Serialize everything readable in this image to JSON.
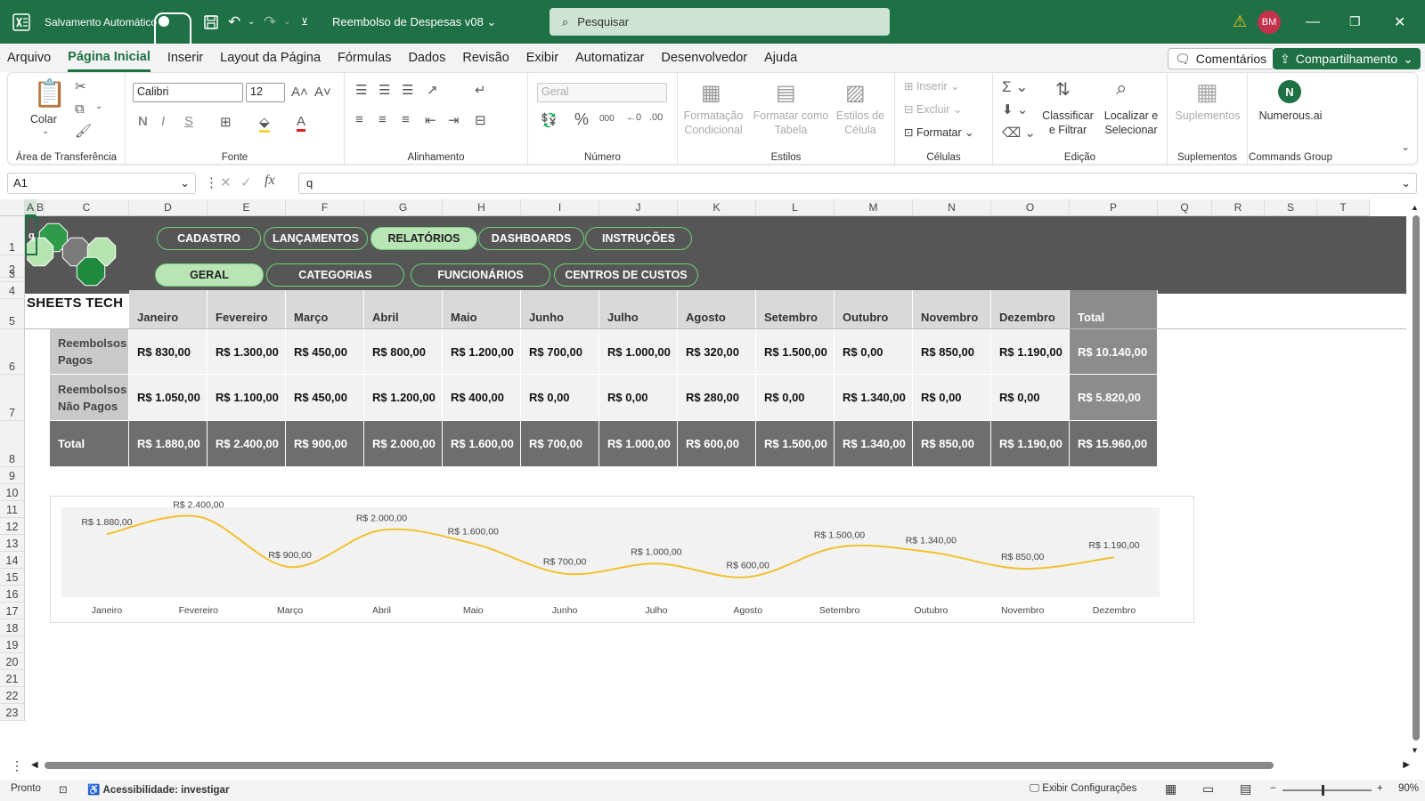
{
  "titlebar": {
    "autosave_label": "Salvamento Automático",
    "doc_title": "Reembolso de Despesas v08",
    "search_placeholder": "Pesquisar",
    "avatar": "BM"
  },
  "menu": {
    "items": [
      "Arquivo",
      "Página Inicial",
      "Inserir",
      "Layout da Página",
      "Fórmulas",
      "Dados",
      "Revisão",
      "Exibir",
      "Automatizar",
      "Desenvolvedor",
      "Ajuda"
    ],
    "active": "Página Inicial",
    "comments": "Comentários",
    "share": "Compartilhamento"
  },
  "ribbon": {
    "clipboard": {
      "paste": "Colar",
      "label": "Área de Transferência"
    },
    "font": {
      "name": "Calibri",
      "size": "12",
      "label": "Fonte",
      "bold": "N",
      "italic": "I",
      "underline": "S"
    },
    "alignment": {
      "label": "Alinhamento"
    },
    "number": {
      "format": "Geral",
      "label": "Número",
      "percent": "%",
      "thousands": "000"
    },
    "styles": {
      "cond": "Formatação Condicional",
      "table": "Formatar como Tabela",
      "cell": "Estilos de Célula",
      "label": "Estilos"
    },
    "cells": {
      "insert": "Inserir",
      "delete": "Excluir",
      "format": "Formatar",
      "label": "Células"
    },
    "editing": {
      "sort": "Classificar e Filtrar",
      "find": "Localizar e Selecionar",
      "label": "Edição"
    },
    "addins": {
      "btn": "Suplementos",
      "label": "Suplementos"
    },
    "commands": {
      "btn": "Numerous.ai",
      "label": "Commands Group"
    }
  },
  "formula_bar": {
    "cell_ref": "A1",
    "content": "q",
    "fx": "fx"
  },
  "columns": [
    "A",
    "B",
    "C",
    "D",
    "E",
    "F",
    "G",
    "H",
    "I",
    "J",
    "K",
    "L",
    "M",
    "N",
    "O",
    "P",
    "Q",
    "R",
    "S",
    "T"
  ],
  "rows": [
    "1",
    "2",
    "3",
    "4",
    "5",
    "6",
    "7",
    "8",
    "9",
    "10",
    "11",
    "12",
    "13",
    "14",
    "15",
    "16",
    "17",
    "18",
    "19",
    "20",
    "21",
    "22",
    "23"
  ],
  "a1_value": "q",
  "nav_top": [
    "CADASTRO",
    "LANÇAMENTOS",
    "RELATÓRIOS",
    "DASHBOARDS",
    "INSTRUÇÕES"
  ],
  "nav_top_active": "RELATÓRIOS",
  "nav_sub": [
    "GERAL",
    "CATEGORIAS",
    "FUNCIONÁRIOS",
    "CENTROS DE CUSTOS"
  ],
  "nav_sub_active": "GERAL",
  "brand": "SHEETS TECH",
  "table": {
    "months": [
      "Janeiro",
      "Fevereiro",
      "Março",
      "Abril",
      "Maio",
      "Junho",
      "Julho",
      "Agosto",
      "Setembro",
      "Outubro",
      "Novembro",
      "Dezembro",
      "Total"
    ],
    "rows": [
      {
        "label": "Reembolsos Pagos",
        "values": [
          "R$ 830,00",
          "R$ 1.300,00",
          "R$ 450,00",
          "R$ 800,00",
          "R$ 1.200,00",
          "R$ 700,00",
          "R$ 1.000,00",
          "R$ 320,00",
          "R$ 1.500,00",
          "R$ 0,00",
          "R$ 850,00",
          "R$ 1.190,00",
          "R$ 10.140,00"
        ]
      },
      {
        "label": "Reembolsos Não Pagos",
        "values": [
          "R$ 1.050,00",
          "R$ 1.100,00",
          "R$ 450,00",
          "R$ 1.200,00",
          "R$ 400,00",
          "R$ 0,00",
          "R$ 0,00",
          "R$ 280,00",
          "R$ 0,00",
          "R$ 1.340,00",
          "R$ 0,00",
          "R$ 0,00",
          "R$ 5.820,00"
        ]
      },
      {
        "label": "Total",
        "values": [
          "R$ 1.880,00",
          "R$ 2.400,00",
          "R$ 900,00",
          "R$ 2.000,00",
          "R$ 1.600,00",
          "R$ 700,00",
          "R$ 1.000,00",
          "R$ 600,00",
          "R$ 1.500,00",
          "R$ 1.340,00",
          "R$ 850,00",
          "R$ 1.190,00",
          "R$ 15.960,00"
        ]
      }
    ]
  },
  "chart_data": {
    "type": "line",
    "categories": [
      "Janeiro",
      "Fevereiro",
      "Março",
      "Abril",
      "Maio",
      "Junho",
      "Julho",
      "Agosto",
      "Setembro",
      "Outubro",
      "Novembro",
      "Dezembro"
    ],
    "values": [
      1880,
      2400,
      900,
      2000,
      1600,
      700,
      1000,
      600,
      1500,
      1340,
      850,
      1190
    ],
    "labels": [
      "R$ 1.880,00",
      "R$ 2.400,00",
      "R$ 900,00",
      "R$ 2.000,00",
      "R$ 1.600,00",
      "R$ 700,00",
      "R$ 1.000,00",
      "R$ 600,00",
      "R$ 1.500,00",
      "R$ 1.340,00",
      "R$ 850,00",
      "R$ 1.190,00"
    ],
    "ylim": [
      0,
      2600
    ],
    "line_color": "#f2c12e",
    "smooth": true,
    "grid": false,
    "legend": "none"
  },
  "status": {
    "ready": "Pronto",
    "accessibility": "Acessibilidade: investigar",
    "display_settings": "Exibir Configurações",
    "zoom": "90%"
  },
  "colors": {
    "brand_green": "#1e7045",
    "banner": "#565656",
    "pill_border": "#6fd07a",
    "pill_active": "#b9e4b6"
  }
}
